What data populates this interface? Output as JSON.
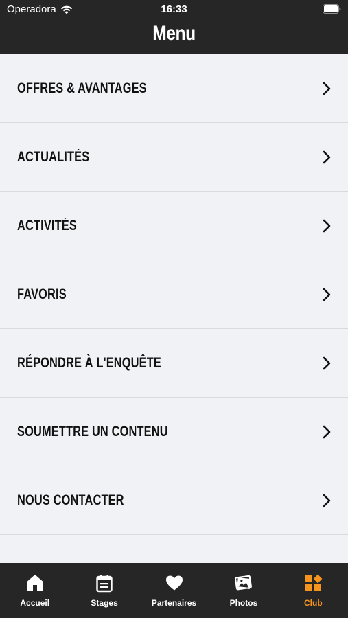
{
  "status_bar": {
    "carrier": "Operadora",
    "time": "16:33",
    "wifi_icon": "wifi-icon",
    "battery_icon": "battery-icon"
  },
  "header": {
    "title": "Menu"
  },
  "menu": {
    "items": [
      {
        "label": "OFFRES & AVANTAGES",
        "icon": "chevron-right-icon"
      },
      {
        "label": "ACTUALITÉS",
        "icon": "chevron-right-icon"
      },
      {
        "label": "ACTIVITÉS",
        "icon": "chevron-right-icon"
      },
      {
        "label": "FAVORIS",
        "icon": "chevron-right-icon"
      },
      {
        "label": "RÉPONDRE À L'ENQUÊTE",
        "icon": "chevron-right-icon"
      },
      {
        "label": "SOUMETTRE UN CONTENU",
        "icon": "chevron-right-icon"
      },
      {
        "label": "NOUS CONTACTER",
        "icon": "chevron-right-icon"
      }
    ]
  },
  "tab_bar": {
    "tabs": [
      {
        "label": "Accueil",
        "icon": "home-icon",
        "active": false
      },
      {
        "label": "Stages",
        "icon": "calendar-icon",
        "active": false
      },
      {
        "label": "Partenaires",
        "icon": "heart-icon",
        "active": false
      },
      {
        "label": "Photos",
        "icon": "photos-icon",
        "active": false
      },
      {
        "label": "Club",
        "icon": "club-grid-icon",
        "active": true
      }
    ]
  },
  "colors": {
    "header_bg": "#262626",
    "page_bg": "#f1f2f6",
    "accent": "#f7941d",
    "divider": "#d9d9de"
  }
}
